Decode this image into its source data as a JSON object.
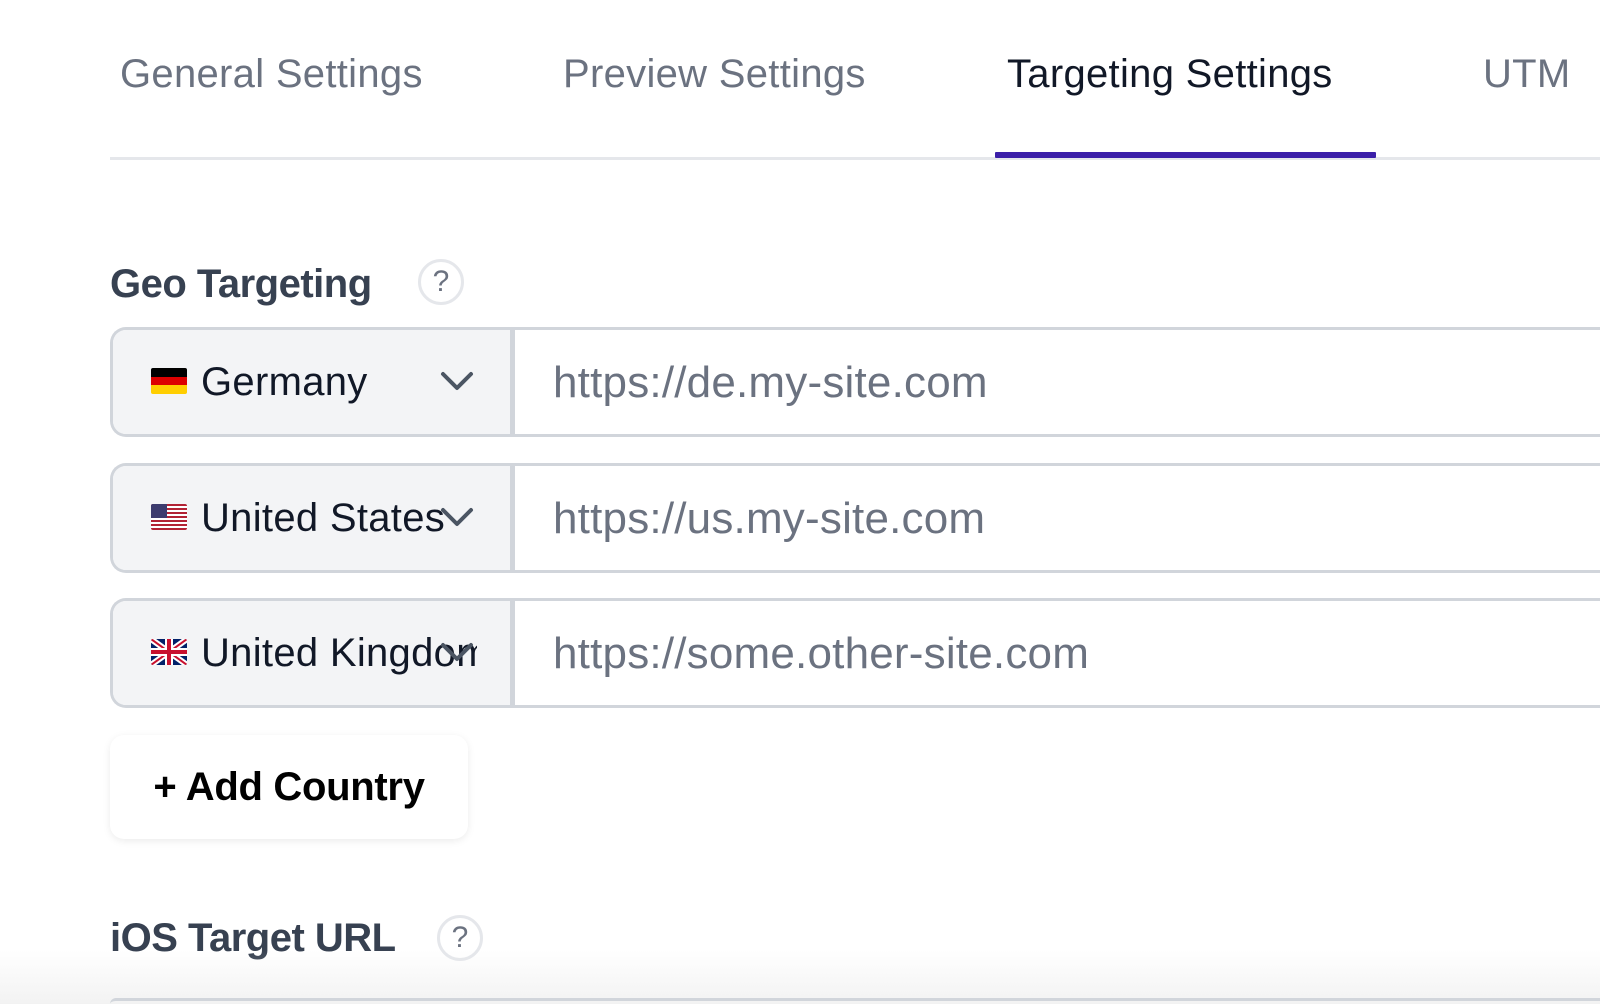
{
  "tabs": [
    {
      "label": "General Settings",
      "active": false
    },
    {
      "label": "Preview Settings",
      "active": false
    },
    {
      "label": "Targeting Settings",
      "active": true
    },
    {
      "label": "UTM",
      "active": false
    }
  ],
  "accent_color": "#3b1fa8",
  "geo_targeting": {
    "title": "Geo Targeting",
    "help_icon": "question-circle-icon",
    "help_glyph": "?",
    "rows": [
      {
        "country": "Germany",
        "flag": "flag-germany-icon",
        "url_placeholder": "https://de.my-site.com"
      },
      {
        "country": "United States",
        "flag": "flag-united-states-icon",
        "url_placeholder": "https://us.my-site.com"
      },
      {
        "country": "United Kingdom",
        "flag": "flag-united-kingdom-icon",
        "url_placeholder": "https://some.other-site.com"
      }
    ],
    "add_button_label": "+ Add Country"
  },
  "ios_target": {
    "title": "iOS Target URL",
    "help_icon": "question-circle-icon",
    "help_glyph": "?"
  }
}
